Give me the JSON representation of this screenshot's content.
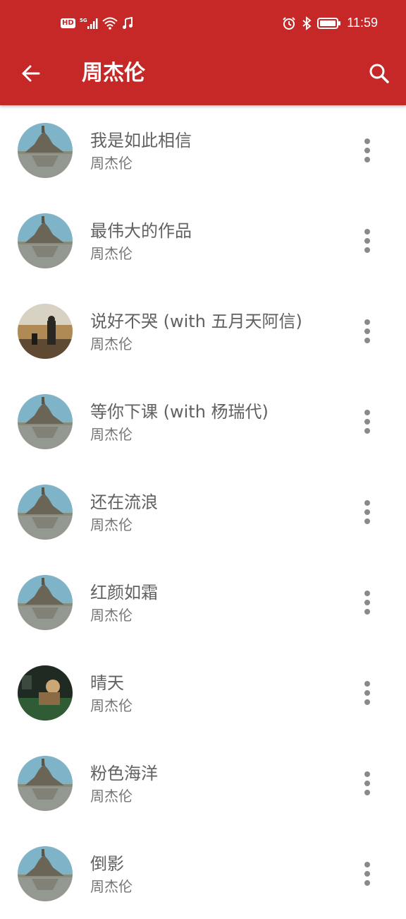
{
  "status_bar": {
    "time": "11:59",
    "network_badge": "HD",
    "network_type": "5G",
    "icons": [
      "hd-icon",
      "signal-icon",
      "wifi-icon",
      "music-note-icon",
      "alarm-icon",
      "bluetooth-icon",
      "battery-icon"
    ]
  },
  "toolbar": {
    "title": "周杰伦",
    "back_icon": "arrow-left-icon",
    "search_icon": "search-icon"
  },
  "colors": {
    "primary": "#c62828",
    "text_primary": "#616161",
    "text_secondary": "#757575"
  },
  "songs": [
    {
      "title": "我是如此相信",
      "artist": "周杰伦",
      "cover": "castle"
    },
    {
      "title": "最伟大的作品",
      "artist": "周杰伦",
      "cover": "castle"
    },
    {
      "title": "说好不哭 (with 五月天阿信)",
      "artist": "周杰伦",
      "cover": "sunset"
    },
    {
      "title": "等你下课 (with 杨瑞代)",
      "artist": "周杰伦",
      "cover": "castle"
    },
    {
      "title": "还在流浪",
      "artist": "周杰伦",
      "cover": "castle"
    },
    {
      "title": "红颜如霜",
      "artist": "周杰伦",
      "cover": "castle"
    },
    {
      "title": "晴天",
      "artist": "周杰伦",
      "cover": "dark"
    },
    {
      "title": "粉色海洋",
      "artist": "周杰伦",
      "cover": "castle"
    },
    {
      "title": "倒影",
      "artist": "周杰伦",
      "cover": "castle"
    }
  ]
}
